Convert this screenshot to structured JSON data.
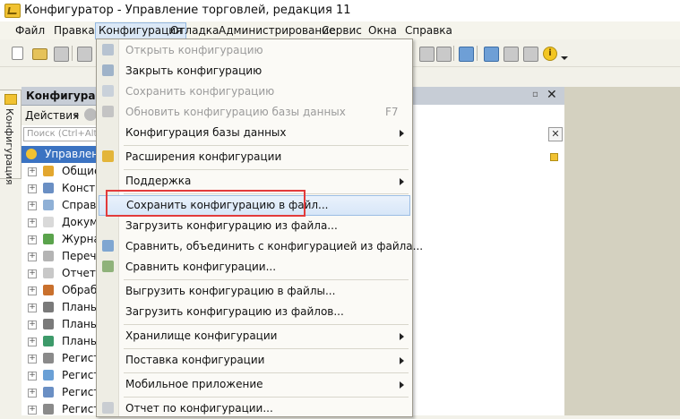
{
  "window": {
    "title": "Конфигуратор - Управление торговлей, редакция 11"
  },
  "menubar": [
    {
      "label": "Файл"
    },
    {
      "label": "Правка"
    },
    {
      "label": "Конфигурация"
    },
    {
      "label": "Отладка"
    },
    {
      "label": "Администрирование"
    },
    {
      "label": "Сервис"
    },
    {
      "label": "Окна"
    },
    {
      "label": "Справка"
    }
  ],
  "side_tab": {
    "label": "Конфигурация"
  },
  "panel": {
    "title": "Конфигурация",
    "actions_label": "Действия",
    "search_placeholder": "Поиск (Ctrl+Alt+M)",
    "tree": [
      {
        "label": "Управление",
        "icon": "config-root-icon",
        "color": "#f1c232",
        "root": true
      },
      {
        "label": "Общие",
        "icon": "common-icon",
        "color": "#e3a72f"
      },
      {
        "label": "Конста",
        "icon": "constants-icon",
        "color": "#6a8fc4"
      },
      {
        "label": "Справо",
        "icon": "catalogs-icon",
        "color": "#8fb0d6"
      },
      {
        "label": "Докуме",
        "icon": "documents-icon",
        "color": "#d9d9d9"
      },
      {
        "label": "Журна",
        "icon": "journals-icon",
        "color": "#5aa34c"
      },
      {
        "label": "Перечи",
        "icon": "enums-icon",
        "color": "#b4b4b4"
      },
      {
        "label": "Отчеты",
        "icon": "reports-icon",
        "color": "#c8c8c8"
      },
      {
        "label": "Обрабо",
        "icon": "dataprocessors-icon",
        "color": "#c9702d"
      },
      {
        "label": "Планы",
        "icon": "chart-characteristics-icon",
        "color": "#7a7a7a"
      },
      {
        "label": "Планы",
        "icon": "chart-accounts-icon",
        "color": "#7a7a7a"
      },
      {
        "label": "Планы",
        "icon": "chart-calculation-icon",
        "color": "#3d9a6a"
      },
      {
        "label": "Регист",
        "icon": "info-registers-icon",
        "color": "#8a8a8a"
      },
      {
        "label": "Регист",
        "icon": "accum-registers-icon",
        "color": "#6aa0d6"
      },
      {
        "label": "Регист",
        "icon": "accounting-registers-icon",
        "color": "#6a8fc4"
      },
      {
        "label": "Регист",
        "icon": "calc-registers-icon",
        "color": "#8a8a8a"
      }
    ]
  },
  "dropdown": {
    "items": [
      {
        "type": "item",
        "label": "Открыть конфигурацию",
        "disabled": true,
        "icon": "open-config-icon",
        "iconColor": "#b7c3d1"
      },
      {
        "type": "item",
        "label": "Закрыть конфигурацию",
        "disabled": false,
        "icon": "close-config-icon",
        "iconColor": "#9fb3c9"
      },
      {
        "type": "item",
        "label": "Сохранить конфигурацию",
        "disabled": true,
        "icon": "save-config-icon",
        "iconColor": "#c9d1da"
      },
      {
        "type": "item",
        "label": "Обновить конфигурацию базы данных",
        "disabled": true,
        "shortcut": "F7",
        "icon": "update-db-icon",
        "iconColor": "#c4c4c4"
      },
      {
        "type": "item",
        "label": "Конфигурация базы данных",
        "submenu": true
      },
      {
        "type": "sep"
      },
      {
        "type": "item",
        "label": "Расширения конфигурации",
        "icon": "extensions-icon",
        "iconColor": "#e3b53a"
      },
      {
        "type": "sep"
      },
      {
        "type": "item",
        "label": "Поддержка",
        "submenu": true
      },
      {
        "type": "sep"
      },
      {
        "type": "item",
        "label": "Сохранить конфигурацию в файл...",
        "highlighted": true
      },
      {
        "type": "item",
        "label": "Загрузить конфигурацию из файла..."
      },
      {
        "type": "item",
        "label": "Сравнить, объединить с конфигурацией из файла...",
        "icon": "merge-icon",
        "iconColor": "#7fa6d1"
      },
      {
        "type": "item",
        "label": "Сравнить конфигурации...",
        "icon": "compare-icon",
        "iconColor": "#8fb27a"
      },
      {
        "type": "sep"
      },
      {
        "type": "item",
        "label": "Выгрузить конфигурацию в файлы..."
      },
      {
        "type": "item",
        "label": "Загрузить конфигурацию из файлов..."
      },
      {
        "type": "sep"
      },
      {
        "type": "item",
        "label": "Хранилище конфигурации",
        "submenu": true
      },
      {
        "type": "sep"
      },
      {
        "type": "item",
        "label": "Поставка конфигурации",
        "submenu": true
      },
      {
        "type": "sep"
      },
      {
        "type": "item",
        "label": "Мобильное приложение",
        "submenu": true
      },
      {
        "type": "sep"
      },
      {
        "type": "item",
        "label": "Отчет по конфигурации...",
        "icon": "report-icon",
        "iconColor": "#c9cdd2"
      }
    ]
  },
  "colors": {
    "highlight_border": "#e23b3b",
    "selection": "#3b73c2"
  }
}
